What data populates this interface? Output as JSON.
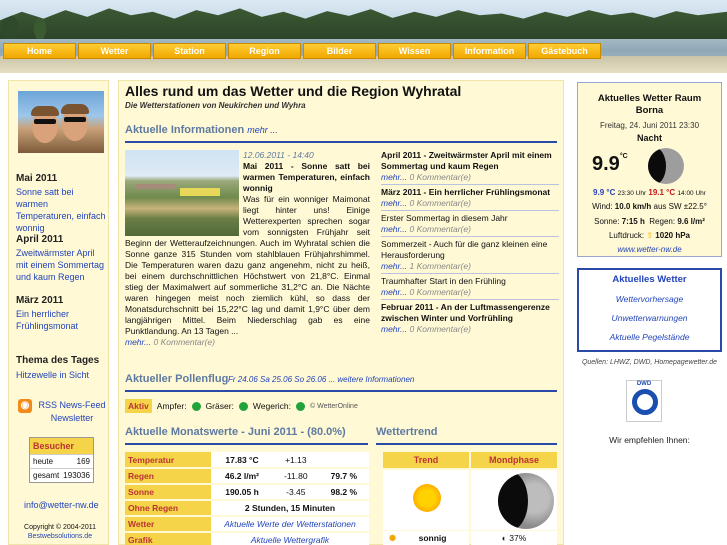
{
  "nav": [
    "Home",
    "Wetter",
    "Station",
    "Region",
    "Bilder",
    "Wissen",
    "Information",
    "Gästebuch"
  ],
  "left": {
    "items": [
      {
        "head": "Mai 2011",
        "text": "Sonne satt bei warmen Temperaturen, einfach wonnig"
      },
      {
        "head": "April 2011",
        "text": "Zweitwärmster April mit einem Sommertag und kaum Regen"
      },
      {
        "head": "März 2011",
        "text": "Ein herrlicher Frühlingsmonat"
      }
    ],
    "thema_head": "Thema des Tages",
    "thema_text": "Hitzewelle in Sicht",
    "rss": "RSS News-Feed Newsletter",
    "counter": {
      "title": "Besucher",
      "rows": [
        {
          "label": "heute",
          "value": "169"
        },
        {
          "label": "gesamt",
          "value": "193036"
        }
      ]
    },
    "email": "info@wetter-nw.de",
    "copyright": "Copyright © 2004-2011",
    "copyright_link": "Bestwebsolutions.de"
  },
  "main": {
    "title": "Alles rund um das Wetter und die Region Wyhratal",
    "subtitle": "Die Wetterstationen von Neukirchen und Wyhra",
    "info_section": "Aktuelle Informationen",
    "more": "mehr ...",
    "article": {
      "date": "12.06.2011 - 14:40",
      "headline": "Mai 2011 - Sonne satt bei warmen Temperaturen, einfach wonnig",
      "body": "Was für ein wonniger Maimonat liegt hinter uns! Einige Wetterexperten sprechen sogar vom sonnigsten Frühjahr seit Beginn der Wetteraufzeichnungen. Auch im Wyhratal schien die Sonne ganze 315 Stunden vom stahlblauen Frühjahrshimmel. Die Temperaturen waren dazu ganz angenehm, nicht zu heiß, bei einem durchschnittlichen Höchstwert von 21,8°C. Einmal stieg der Maximalwert auf sommerliche 31,2°C an. Die Nächte waren hingegen meist noch ziemlich kühl, so dass der Monatsdurchschnitt bei 15,22°C lag und damit 1,9°C über dem langjährigen Mittel. Beim Niederschlag gab es eine Punktlandung. An 13 Tagen ...",
      "more": "mehr...",
      "comments": "0 Kommentar(e)"
    },
    "news": [
      {
        "headline": "April 2011 - Zweitwärmster April mit einem Sommertag und kaum Regen",
        "bold": true,
        "comments": "0 Kommentar(e)"
      },
      {
        "headline": "März 2011 - Ein herrlicher Frühlingsmonat",
        "bold": true,
        "comments": "0 Kommentar(e)"
      },
      {
        "headline": "Erster Sommertag in diesem Jahr",
        "bold": false,
        "comments": "0 Kommentar(e)"
      },
      {
        "headline": "Sommerzeit - Auch für die ganz kleinen eine Herausforderung",
        "bold": false,
        "comments": "1 Kommentar(e)"
      },
      {
        "headline": "Traumhafter Start in den Frühling",
        "bold": false,
        "comments": "0 Kommentar(e)"
      },
      {
        "headline": "Februar 2011 - An der Luftmassengerenze zwischen Winter und Vorfrühling",
        "bold": true,
        "comments": "0 Kommentar(e)"
      }
    ],
    "news_more": "mehr...",
    "pollen_section": "Aktueller Pollenflug",
    "pollen_dates": "Fr 24.06  Sa 25.06  So 26.06  ... weitere Informationen",
    "pollen_badge": "Aktiv",
    "pollen": [
      "Ampfer:",
      "Gräser:",
      "Wegerich:"
    ],
    "pollen_source": "© WetterOnline",
    "monat_section": "Aktuelle Monatswerte - Juni 2011 - (80.0%)",
    "trend_section": "Wettertrend",
    "monat_rows": [
      {
        "label": "Temperatur",
        "v1": "17.83 °C",
        "v2": "+1.13",
        "v3": ""
      },
      {
        "label": "Regen",
        "v1": "46.2 l/m²",
        "v2": "-11.80",
        "v3": "79.7 %"
      },
      {
        "label": "Sonne",
        "v1": "190.05 h",
        "v2": "-3.45",
        "v3": "98.2 %"
      },
      {
        "label": "Ohne Regen",
        "v1": "2 Stunden, 15 Minuten",
        "v2": "",
        "v3": ""
      },
      {
        "label": "Wetter",
        "v1": "Aktuelle Werte der Wetterstationen",
        "v2": "",
        "v3": ""
      },
      {
        "label": "Grafik",
        "v1": "Aktuelle Wettergrafik",
        "v2": "",
        "v3": ""
      }
    ],
    "trend_head": "Trend",
    "moon_head": "Mondphase",
    "trend_text": "sonnig",
    "moon_text": "37%"
  },
  "right": {
    "wx_title": "Aktuelles Wetter Raum",
    "wx_place": "Borna",
    "wx_date": "Freitag, 24. Juni 2011 23:30",
    "wx_phase": "Nacht",
    "wx_temp": "9.9",
    "wx_temp_unit": "°C",
    "wx_min": "9.9 °C",
    "wx_min_time": "23:30 Uhr",
    "wx_max": "19.1 °C",
    "wx_max_time": "14:00 Uhr",
    "wind_label": "Wind:",
    "wind_value": "10.0 km/h",
    "wind_dir": "aus SW ±22.5°",
    "sonne_label": "Sonne:",
    "sonne_value": "7:15 h",
    "regen_label": "Regen:",
    "regen_value": "9.6 l/m²",
    "druck_label": "Luftdruck:",
    "druck_value": "1020 hPa",
    "wx_link": "www.wetter-nw.de",
    "aw_title": "Aktuelles Wetter",
    "aw_links": [
      "Wettervorhersage",
      "Unwetterwarnungen",
      "Aktuelle Pegelstände"
    ],
    "quellen": "Quellen: LHWZ, DWD, Homepagewetter.de",
    "dwd": "DWD",
    "recommend": "Wir empfehlen Ihnen:"
  },
  "colors": {
    "accent": "#2a4aa8",
    "link": "#2244bb",
    "nav": "#f0a800",
    "panel": "#fff9d6",
    "label_red": "#b33"
  }
}
